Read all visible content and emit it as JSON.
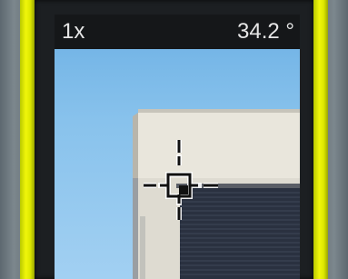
{
  "viewfinder": {
    "zoom_label": "1x",
    "angle_label": "34.2 °"
  },
  "icons": {
    "crosshair": "crosshair-target-icon"
  },
  "colors": {
    "device_accent": "#f0f60a",
    "sky": "#88c2ec",
    "status_bar": "#151719",
    "status_text": "#e6e6e6"
  }
}
